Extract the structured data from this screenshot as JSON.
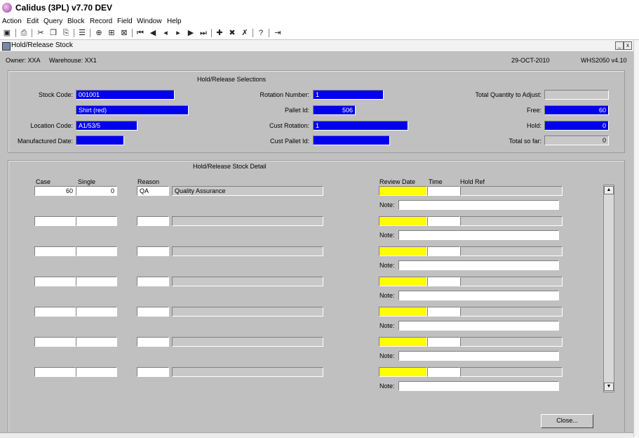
{
  "window": {
    "title": "Calidus (3PL) v7.70 DEV"
  },
  "menu": [
    "Action",
    "Edit",
    "Query",
    "Block",
    "Record",
    "Field",
    "Window",
    "Help"
  ],
  "form": {
    "title": "Hold/Release Stock",
    "min_label": "_",
    "close_label": "x"
  },
  "header": {
    "owner": "Owner: XXA",
    "warehouse": "Warehouse: XX1",
    "date": "29-OCT-2010",
    "form_id": "WHS2050  v4.10"
  },
  "selections": {
    "title": "Hold/Release Selections",
    "stock_code_label": "Stock Code:",
    "stock_code": "001001",
    "description": "Shirt (red)",
    "location_code_label": "Location Code:",
    "location_code": "A1/53/5",
    "manufactured_date_label": "Manufactured Date:",
    "manufactured_date": "",
    "rotation_number_label": "Rotation Number:",
    "rotation_number": "1",
    "pallet_id_label": "Pallet Id:",
    "pallet_id": "506",
    "cust_rotation_label": "Cust Rotation:",
    "cust_rotation": "1",
    "cust_pallet_id_label": "Cust Pallet Id:",
    "cust_pallet_id": "",
    "total_qty_label": "Total Quantity to Adjust:",
    "total_qty": "",
    "free_label": "Free:",
    "free": "60",
    "hold_label": "Hold:",
    "hold": "0",
    "total_so_far_label": "Total so far:",
    "total_so_far": "0"
  },
  "detail": {
    "title": "Hold/Release Stock Detail",
    "col_case": "Case",
    "col_single": "Single",
    "col_reason": "Reason",
    "col_review_date": "Review Date",
    "col_time": "Time",
    "col_hold_ref": "Hold Ref",
    "note_label": "Note:",
    "rows": [
      {
        "case": "60",
        "single": "0",
        "reason": "QA",
        "reason_desc": "Quality Assurance",
        "review_date": "",
        "time": "",
        "hold_ref": "",
        "note": ""
      },
      {
        "case": "",
        "single": "",
        "reason": "",
        "reason_desc": "",
        "review_date": "",
        "time": "",
        "hold_ref": "",
        "note": ""
      },
      {
        "case": "",
        "single": "",
        "reason": "",
        "reason_desc": "",
        "review_date": "",
        "time": "",
        "hold_ref": "",
        "note": ""
      },
      {
        "case": "",
        "single": "",
        "reason": "",
        "reason_desc": "",
        "review_date": "",
        "time": "",
        "hold_ref": "",
        "note": ""
      },
      {
        "case": "",
        "single": "",
        "reason": "",
        "reason_desc": "",
        "review_date": "",
        "time": "",
        "hold_ref": "",
        "note": ""
      },
      {
        "case": "",
        "single": "",
        "reason": "",
        "reason_desc": "",
        "review_date": "",
        "time": "",
        "hold_ref": "",
        "note": ""
      },
      {
        "case": "",
        "single": "",
        "reason": "",
        "reason_desc": "",
        "review_date": "",
        "time": "",
        "hold_ref": "",
        "note": ""
      }
    ]
  },
  "buttons": {
    "close": "Close..."
  },
  "icons": [
    "save-icon",
    "print-icon",
    "cut-icon",
    "copy-icon",
    "paste-icon",
    "list-icon",
    "enter-query-icon",
    "execute-query-icon",
    "cancel-query-icon",
    "first-record-icon",
    "prev-block-icon",
    "prev-record-icon",
    "next-record-icon",
    "next-block-icon",
    "last-record-icon",
    "insert-record-icon",
    "delete-record-icon",
    "clear-record-icon",
    "help-icon",
    "exit-icon"
  ],
  "colors": {
    "field_blue": "#0000ee",
    "field_yellow": "#ffff00",
    "panel_gray": "#c0c0c0"
  }
}
